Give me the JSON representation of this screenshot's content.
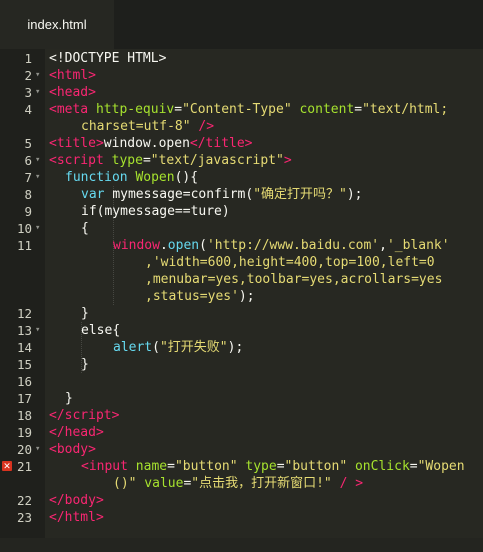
{
  "tab": {
    "title": "index.html"
  },
  "lines": [
    {
      "n": "1"
    },
    {
      "n": "2"
    },
    {
      "n": "3"
    },
    {
      "n": "4"
    },
    {
      "n": "5"
    },
    {
      "n": "6"
    },
    {
      "n": "7"
    },
    {
      "n": "8"
    },
    {
      "n": "9"
    },
    {
      "n": "10"
    },
    {
      "n": "11"
    },
    {
      "n": "12"
    },
    {
      "n": "13"
    },
    {
      "n": "14"
    },
    {
      "n": "15"
    },
    {
      "n": "16"
    },
    {
      "n": "17"
    },
    {
      "n": "18"
    },
    {
      "n": "19"
    },
    {
      "n": "20"
    },
    {
      "n": "21"
    },
    {
      "n": "22"
    },
    {
      "n": "23"
    }
  ],
  "code": {
    "l1": "<!DOCTYPE HTML>",
    "l2": "<html>",
    "l3": "<head>",
    "l4a_tag": "<meta ",
    "l4a_attr1": "http-equiv",
    "l4a_eq1": "=",
    "l4a_val1": "\"Content-Type\"",
    "l4a_attr2": " content",
    "l4a_eq2": "=",
    "l4a_val2": "\"text/html;",
    "l4b_val": "charset=utf-8\"",
    "l4b_close": " />",
    "l5_open": "<title>",
    "l5_text": "window.open",
    "l5_close": "</title>",
    "l6_tag": "<script ",
    "l6_attr": "type",
    "l6_eq": "=",
    "l6_val": "\"text/javascript\"",
    "l6_close": ">",
    "l7_kw": "function ",
    "l7_name": "Wopen",
    "l7_rest": "(){",
    "l8_kw": "var ",
    "l8_rest": "mymessage=confirm(",
    "l8_str": "\"确定打开吗？\"",
    "l8_end": ");",
    "l9": "if(mymessage==ture)",
    "l10": "{",
    "l11a_obj": "window",
    "l11a_dot": ".",
    "l11a_fn": "open",
    "l11a_p": "(",
    "l11a_s1": "'http://www.baidu.com'",
    "l11a_c": ",",
    "l11a_s2": "'_blank'",
    "l11b": ",'width=600,height=400,top=100,left=0",
    "l11c": ",menubar=yes,toolbar=yes,acrollars=yes",
    "l11d": ",status=yes'",
    "l11d_end": ");",
    "l12": "}",
    "l13_kw": "else",
    "l13_rest": "{",
    "l14_fn": "alert",
    "l14_p": "(",
    "l14_str": "\"打开失败\"",
    "l14_end": ");",
    "l15": "}",
    "l17": "}",
    "l18_open": "</",
    "l18_name": "script",
    "l18_close": ">",
    "l19": "</head>",
    "l20": "<body>",
    "l21a_tag": "<input ",
    "l21a_attr1": "name",
    "l21a_eq1": "=",
    "l21a_val1": "\"button\"",
    "l21a_attr2": " type",
    "l21a_eq2": "=",
    "l21a_val2": "\"button\"",
    "l21a_attr3": " onClick",
    "l21a_eq3": "=",
    "l21a_val3": "\"Wopen",
    "l21b_val3": "()\"",
    "l21b_attr4": " value",
    "l21b_eq4": "=",
    "l21b_val4": "\"点击我，打开新窗口!\"",
    "l21b_close": " / >",
    "l22": "</body>",
    "l23": "</html>"
  },
  "folds": {
    "marker": "▾"
  },
  "error_icon": "error-marker-icon",
  "colors": {
    "tag": "#f92672",
    "attr": "#a6e22e",
    "string": "#e6db74",
    "keyword": "#66d9ef",
    "text": "#f8f8f2",
    "background": "#272822"
  }
}
